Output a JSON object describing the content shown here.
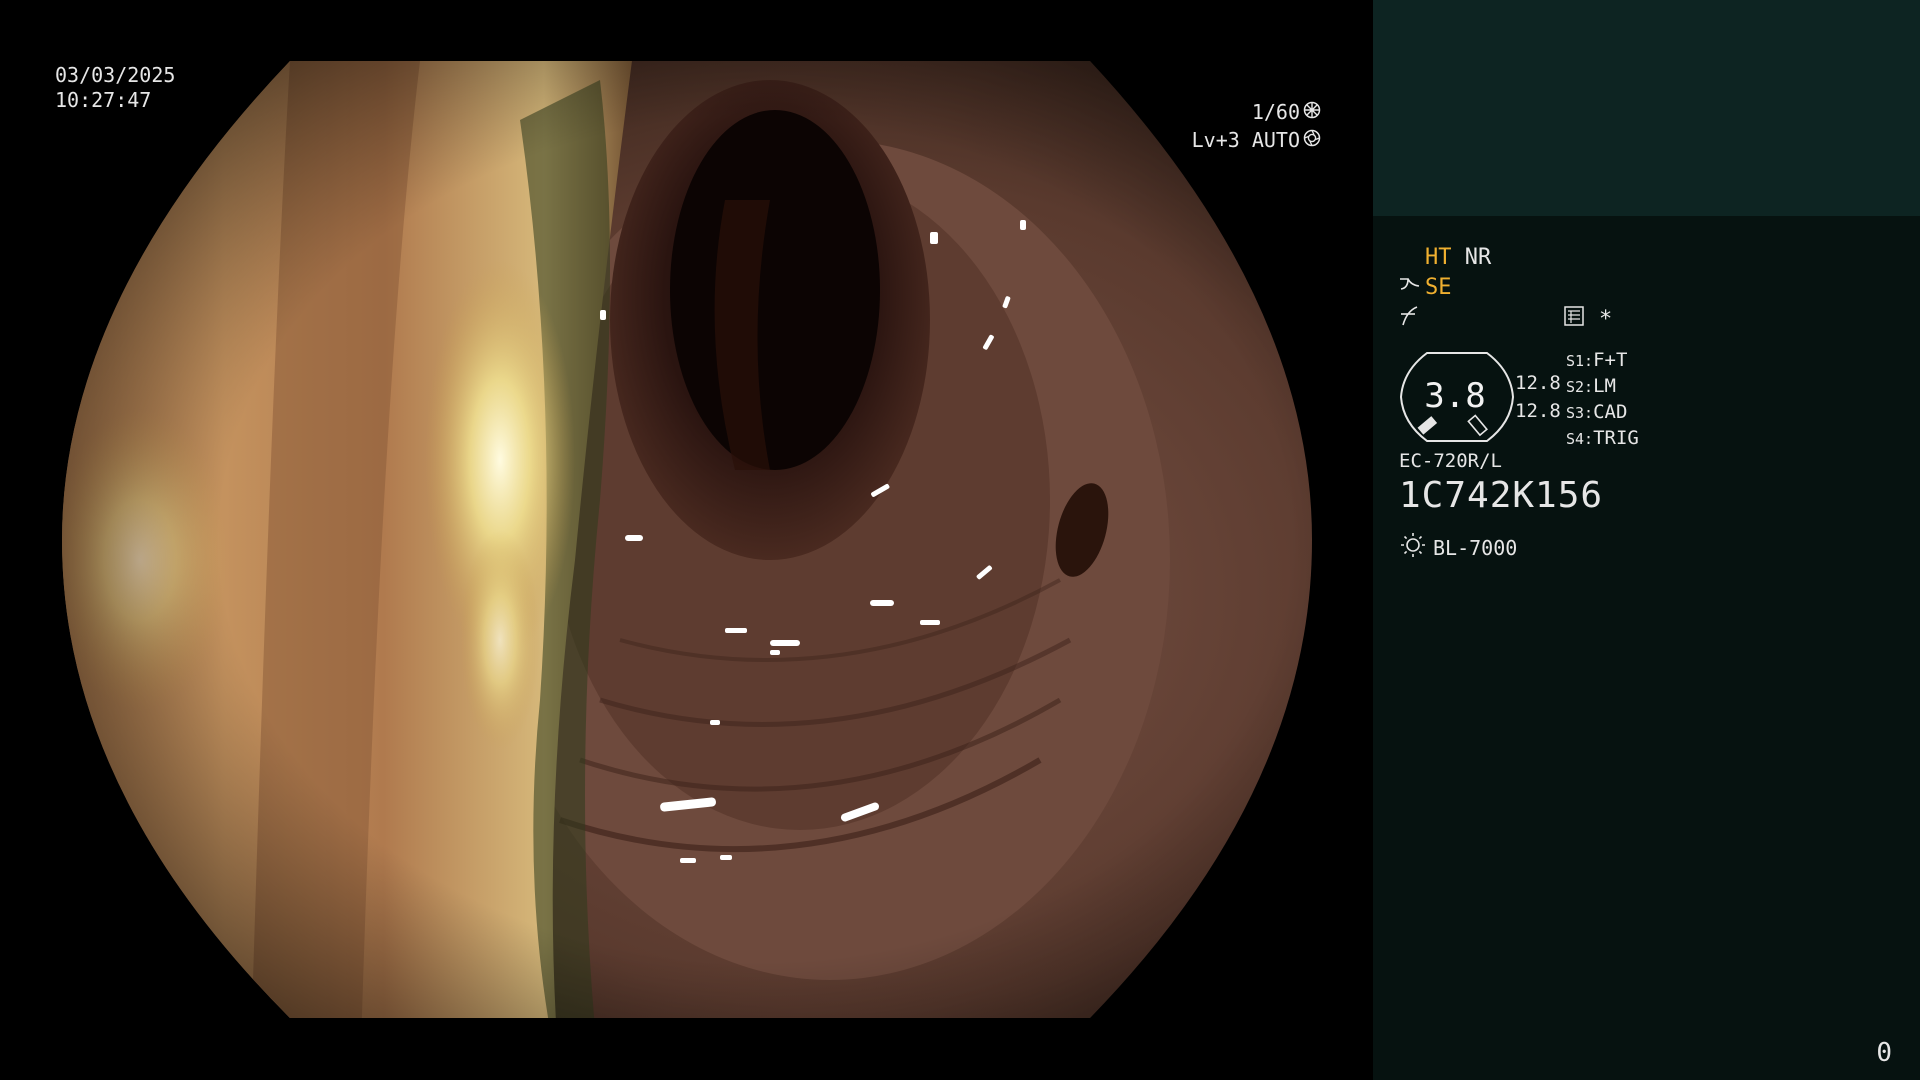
{
  "endoscope_view": {
    "date": "03/03/2025",
    "time": "10:27:47",
    "shutter": "1/60",
    "shutter_icon": "aperture-icon",
    "brightness": "Lv+3 AUTO",
    "brightness_icon": "iris-icon"
  },
  "info_panel": {
    "ht": "HT",
    "nr": "NR",
    "se": "SE",
    "se_icon": "structure-enhance-icon",
    "slope_icon": "slope-icon",
    "memory_icon": "memory-card-icon",
    "asterisk": "*",
    "zoom_value": "3.8",
    "zoom_num_1": "12.8",
    "zoom_num_2": "12.8",
    "switches": [
      {
        "key": "S1:",
        "value": "F+T"
      },
      {
        "key": "S2:",
        "value": "LM"
      },
      {
        "key": "S3:",
        "value": "CAD"
      },
      {
        "key": "S4:",
        "value": "TRIG"
      }
    ],
    "scope_model": "EC-720R/L",
    "scope_serial": "1C742K156",
    "light_source": "BL-7000",
    "light_icon": "light-source-icon",
    "frame_count": "0",
    "colors": {
      "amber": "#f0b030",
      "panel_bg": "#061210",
      "panel_top": "#0d2422"
    }
  }
}
